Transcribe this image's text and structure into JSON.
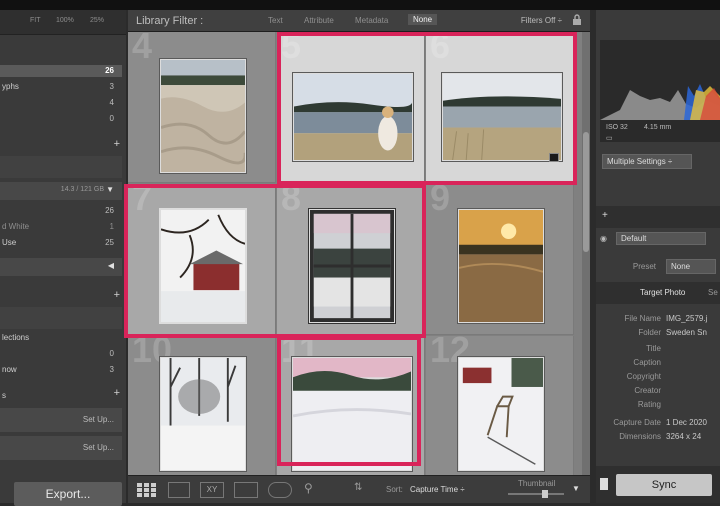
{
  "navigator": {
    "zoom": [
      "FIT",
      "100%",
      "25%"
    ]
  },
  "catalog": {
    "rows": [
      {
        "label": "",
        "count": "26"
      },
      {
        "label": "yphs",
        "count": "3"
      },
      {
        "label": "",
        "count": "4"
      },
      {
        "label": "",
        "count": "0"
      }
    ]
  },
  "folders": {
    "volume": "14.3 / 121 GB",
    "rows": [
      {
        "label": "",
        "count": "26"
      },
      {
        "label": "d White",
        "count": "1"
      },
      {
        "label": "Use",
        "count": "25"
      }
    ]
  },
  "collections": {
    "rows": [
      {
        "label": "lections",
        "count": ""
      },
      {
        "label": "",
        "count": "0"
      },
      {
        "label": "now",
        "count": "3"
      }
    ]
  },
  "publish": {
    "label": "s",
    "setup": [
      "Set Up...",
      "Set Up..."
    ]
  },
  "export_label": "Export...",
  "filter": {
    "title": "Library Filter :",
    "tabs": [
      "Text",
      "Attribute",
      "Metadata",
      "None"
    ],
    "selected": "None",
    "status": "Filters Off ÷"
  },
  "grid": {
    "cells": [
      {
        "num": "4",
        "selected": false,
        "bright": false,
        "photo": "frost"
      },
      {
        "num": "5",
        "selected": true,
        "bright": true,
        "photo": "lake-girl"
      },
      {
        "num": "6",
        "selected": true,
        "bright": true,
        "photo": "lake"
      },
      {
        "num": "7",
        "selected": true,
        "bright": false,
        "photo": "snow-house"
      },
      {
        "num": "8",
        "selected": true,
        "bright": false,
        "photo": "window"
      },
      {
        "num": "9",
        "selected": false,
        "bright": false,
        "photo": "sunset"
      },
      {
        "num": "10",
        "selected": false,
        "bright": false,
        "photo": "snow-trees"
      },
      {
        "num": "11",
        "selected": true,
        "bright": false,
        "photo": "snow-field"
      },
      {
        "num": "12",
        "selected": false,
        "bright": false,
        "photo": "snow-chair"
      }
    ]
  },
  "toolbar": {
    "sort_label": "Sort:",
    "sort_value": "Capture Time ÷",
    "thumb_label": "Thumbnail"
  },
  "histogram": {
    "iso": "ISO 32",
    "focal": "4.15 mm",
    "multiple": "Multiple Settings ÷"
  },
  "quick_develop": {
    "preset": "Default"
  },
  "metadata": {
    "preset_label": "Preset",
    "preset_value": "None",
    "target_tab": "Target Photo",
    "target_tab_2": "Se",
    "fields": [
      {
        "label": "File Name",
        "value": "IMG_2579.j"
      },
      {
        "label": "Folder",
        "value": "Sweden Sn"
      },
      {
        "label": "Title",
        "value": ""
      },
      {
        "label": "Caption",
        "value": ""
      },
      {
        "label": "Copyright",
        "value": ""
      },
      {
        "label": "Creator",
        "value": ""
      },
      {
        "label": "Rating",
        "value": ""
      },
      {
        "label": "Capture Date",
        "value": "1 Dec 2020"
      },
      {
        "label": "Dimensions",
        "value": "3264 x 24"
      }
    ]
  },
  "sync_label": "Sync",
  "colors": {
    "highlight": "#d9245a",
    "panel": "#3a3a3a",
    "grid": "#808080"
  }
}
